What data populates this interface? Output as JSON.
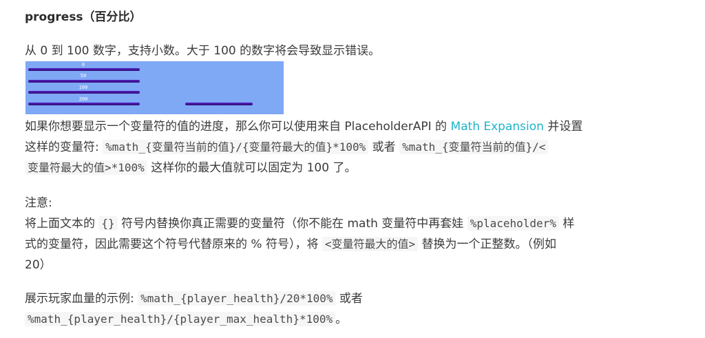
{
  "heading": "progress（百分比）",
  "intro": "从 0 到 100 数字，支持小数。大于 100 的数字将会导致显示错误。",
  "demo": {
    "labels": [
      "0",
      "50",
      "100",
      "200"
    ],
    "progress_values": [
      0,
      50,
      100,
      200
    ]
  },
  "para2": {
    "t1": "如果你想要显示一个变量符的值的进度，那么你可以使用来自 PlaceholderAPI 的 ",
    "link": "Math Expansion",
    "t2": " 并设置",
    "t3": "这样的变量符: ",
    "c1": "%math_{变量符当前的值}/{变量符最大的值}*100%",
    "t4": " 或者 ",
    "c2a": "%math_{变量符当前的值}/<",
    "c2b": "变量符最大的值>*100%",
    "t5": " 这样你的最大值就可以固定为 100 了。"
  },
  "note": {
    "label": "注意:",
    "t1": "将上面文本的 ",
    "c1": "{}",
    "t2": " 符号内替换你真正需要的变量符（你不能在 math 变量符中再套娃 ",
    "c2": "%placeholder%",
    "t3": " 样",
    "t4": "式的变量符，因此需要这个符号代替原来的 % 符号），将 ",
    "c3": "<变量符最大的值>",
    "t5": " 替换为一个正整数。（例如",
    "t6": "20）"
  },
  "example": {
    "t1": "展示玩家血量的示例: ",
    "c1": "%math_{player_health}/20*100%",
    "t2": " 或者",
    "c2": "%math_{player_health}/{player_max_health}*100%",
    "t3": "。"
  },
  "colors": {
    "link": "#1fb5c9",
    "demo_bg": "#7fa8f5",
    "bar": "#4a1aa8"
  }
}
